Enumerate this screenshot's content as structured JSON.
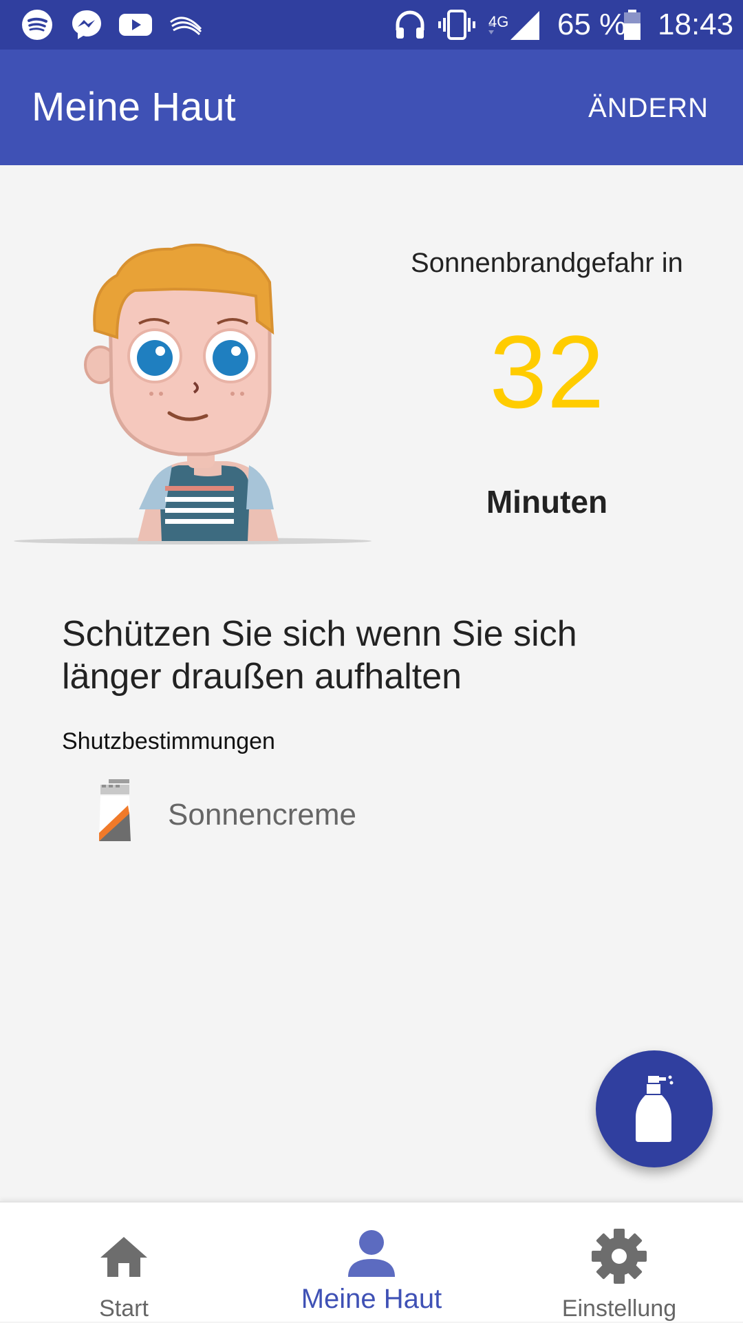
{
  "status_bar": {
    "battery": "65 %",
    "network": "4G",
    "time": "18:43",
    "icons": [
      "spotify-icon",
      "messenger-icon",
      "youtube-icon",
      "swiftkey-icon",
      "headphones-icon",
      "vibrate-icon",
      "signal-icon",
      "battery-icon"
    ]
  },
  "app_bar": {
    "title": "Meine Haut",
    "action_label": "ÄNDERN"
  },
  "risk": {
    "caption": "Sonnenbrandgefahr in",
    "value": "32",
    "unit": "Minuten"
  },
  "advice": {
    "text": "Schützen Sie sich wenn Sie sich länger draußen aufhalten"
  },
  "protection": {
    "section_label": "Shutzbestimmungen",
    "items": [
      {
        "label": "Sonnencreme",
        "icon": "sunscreen-icon"
      }
    ]
  },
  "fab": {
    "icon": "sunscreen-bottle-icon"
  },
  "bottom_nav": {
    "items": [
      {
        "label": "Start",
        "icon": "home-icon",
        "active": false
      },
      {
        "label": "Meine Haut",
        "icon": "person-icon",
        "active": true
      },
      {
        "label": "Einstellung",
        "icon": "gear-icon",
        "active": false
      }
    ]
  },
  "colors": {
    "status_bar": "#303f9f",
    "app_bar": "#3f51b5",
    "accent_value": "#ffcc00",
    "nav_active": "#3f51b5"
  }
}
